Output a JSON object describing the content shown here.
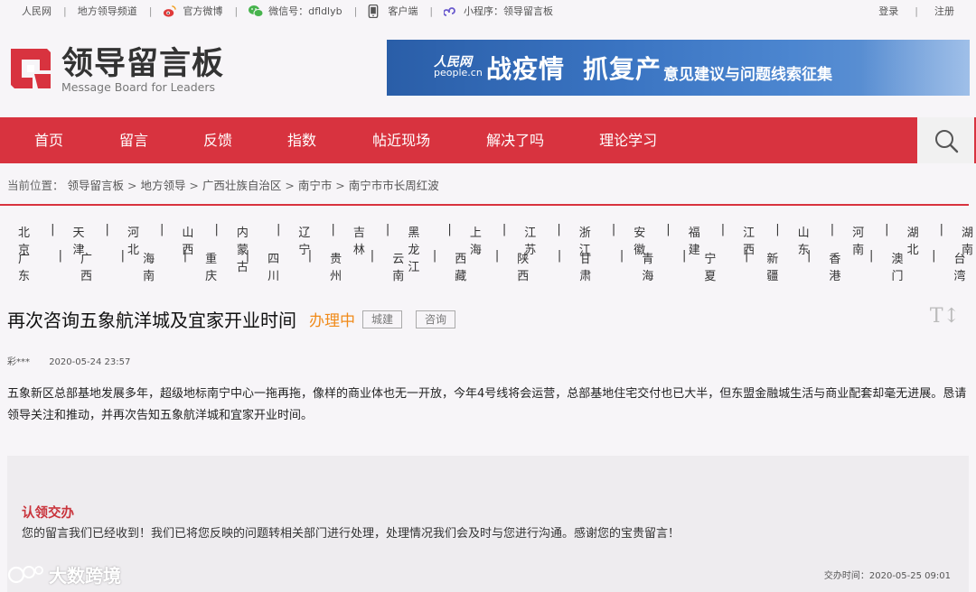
{
  "topbar": {
    "links": [
      "人民网",
      "地方领导频道",
      "官方微博",
      "微信号：dfldlyb",
      "客户端",
      "小程序：领导留言板"
    ],
    "login": "登录",
    "register": "注册"
  },
  "logo": {
    "cn": "领导留言板",
    "en": "Message Board for Leaders"
  },
  "banner": {
    "brand_top": "人民网",
    "brand_bottom": "people.cn",
    "title1": "战疫情",
    "title2": "抓复产",
    "title3": "意见建议与问题线索征集"
  },
  "nav": {
    "items": [
      "首页",
      "留言",
      "反馈",
      "指数",
      "帖近现场",
      "解决了吗",
      "理论学习"
    ]
  },
  "breadcrumb": {
    "prefix": "当前位置：",
    "items": [
      "领导留言板",
      "地方领导",
      "广西壮族自治区",
      "南宁市",
      "南宁市市长周红波"
    ]
  },
  "provinces": {
    "row1": [
      "北京",
      "天津",
      "河北",
      "山西",
      "内蒙古",
      "辽宁",
      "吉林",
      "黑龙江",
      "上海",
      "江苏",
      "浙江",
      "安徽",
      "福建",
      "江西",
      "山东",
      "河南",
      "湖北",
      "湖南"
    ],
    "row2": [
      "广东",
      "广西",
      "海南",
      "重庆",
      "四川",
      "贵州",
      "云南",
      "西藏",
      "陕西",
      "甘肃",
      "青海",
      "宁夏",
      "新疆",
      "香港",
      "澳门",
      "台湾"
    ]
  },
  "post": {
    "title": "再次咨询五象航洋城及宜家开业时间",
    "status": "办理中",
    "tags": [
      "城建",
      "咨询"
    ],
    "font_toggle": "T↕",
    "author": "彩***",
    "date": "2020-05-24 23:57",
    "body": "五象新区总部基地发展多年，超级地标南宁中心一拖再拖，像样的商业体也无一开放，今年4号线将会运营，总部基地住宅交付也已大半，但东盟金融城生活与商业配套却毫无进展。恳请领导关注和推动，并再次告知五象航洋城和宜家开业时间。"
  },
  "reply": {
    "title": "认领交办",
    "body": "您的留言我们已经收到！我们已将您反映的问题转相关部门进行处理，处理情况我们会及时与您进行沟通。感谢您的宝贵留言！",
    "time": "交办时间：2020-05-25 09:01"
  },
  "watermark": "大数跨境",
  "colors": {
    "brand_red": "#d8333f",
    "status_orange": "#f08a19",
    "reply_title_red": "#c9343c"
  }
}
